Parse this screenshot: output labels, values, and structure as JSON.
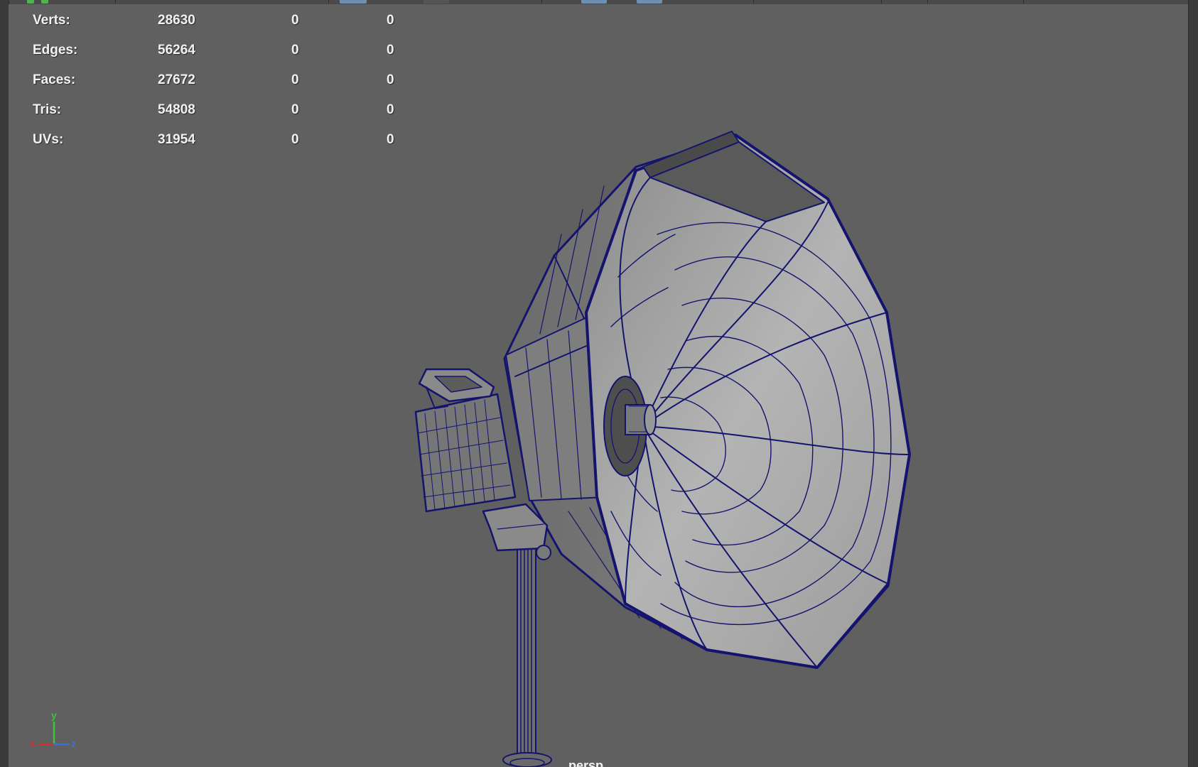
{
  "viewport": {
    "camera_name": "persp"
  },
  "heads_up_display": {
    "rows": [
      {
        "label": "Verts:",
        "values": [
          "28630",
          "0",
          "0"
        ]
      },
      {
        "label": "Edges:",
        "values": [
          "56264",
          "0",
          "0"
        ]
      },
      {
        "label": "Faces:",
        "values": [
          "27672",
          "0",
          "0"
        ]
      },
      {
        "label": "Tris:",
        "values": [
          "54808",
          "0",
          "0"
        ]
      },
      {
        "label": "UVs:",
        "values": [
          "31954",
          "0",
          "0"
        ]
      }
    ]
  },
  "axis_gizmo": {
    "x_label": "x",
    "y_label": "y",
    "z_label": "z",
    "x_color": "#d03030",
    "y_color": "#40c040",
    "z_color": "#3a6fd8"
  },
  "colors": {
    "viewport_background": "#606060",
    "wireframe": "#14146e"
  },
  "model": {
    "display_mode": "wireframe on shaded",
    "subject": "softbox studio light on stand"
  }
}
